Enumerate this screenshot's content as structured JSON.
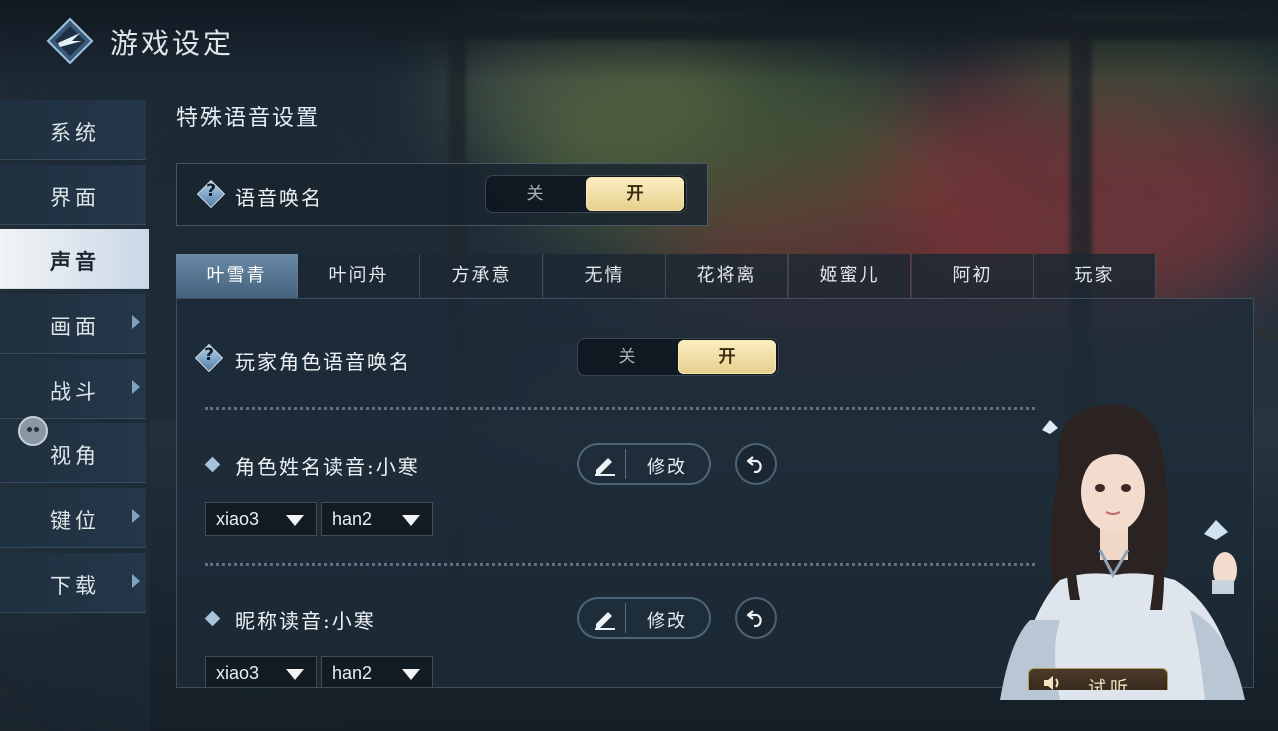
{
  "header": {
    "title": "游戏设定",
    "logo_icon": "game-logo-icon"
  },
  "sidebar": {
    "items": [
      {
        "label": "系统",
        "has_arrow": false,
        "active": false
      },
      {
        "label": "界面",
        "has_arrow": false,
        "active": false
      },
      {
        "label": "声音",
        "has_arrow": false,
        "active": true
      },
      {
        "label": "画面",
        "has_arrow": true,
        "active": false
      },
      {
        "label": "战斗",
        "has_arrow": true,
        "active": false
      },
      {
        "label": "视角",
        "has_arrow": false,
        "active": false
      },
      {
        "label": "键位",
        "has_arrow": true,
        "active": false
      },
      {
        "label": "下载",
        "has_arrow": true,
        "active": false
      }
    ]
  },
  "section": {
    "title": "特殊语音设置"
  },
  "voice_call": {
    "label": "语音唤名",
    "off_label": "关",
    "on_label": "开",
    "value": "开"
  },
  "tabs": [
    "叶雪青",
    "叶问舟",
    "方承意",
    "无情",
    "花将离",
    "姬蜜儿",
    "阿初",
    "玩家"
  ],
  "active_tab": "叶雪青",
  "panel": {
    "player_voice_call": {
      "label": "玩家角色语音唤名",
      "off_label": "关",
      "on_label": "开",
      "value": "开"
    },
    "name_reading": {
      "label": "角色姓名读音:小寒",
      "edit_label": "修改",
      "syllables": [
        "xiao3",
        "han2"
      ]
    },
    "nickname_reading": {
      "label": "昵称读音:小寒",
      "edit_label": "修改",
      "syllables": [
        "xiao3",
        "han2"
      ]
    }
  },
  "listen_button": {
    "label": "试听"
  },
  "colors": {
    "accent_gold": "#e6cf8d",
    "active_tab": "#5a7a96",
    "panel_bg": "#1e2c38"
  }
}
